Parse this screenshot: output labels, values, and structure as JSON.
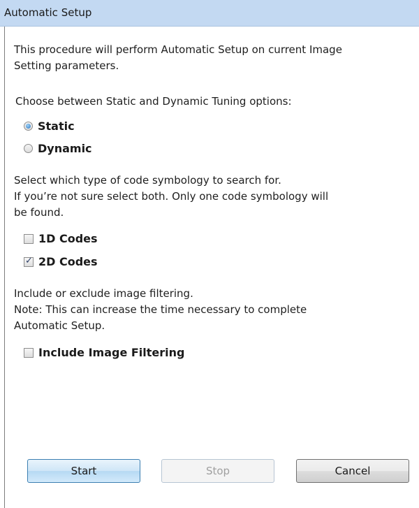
{
  "window": {
    "title": "Automatic Setup"
  },
  "intro": {
    "line1": "This procedure will perform Automatic Setup on current Image",
    "line2": "Setting parameters."
  },
  "tuning": {
    "prompt": "Choose between Static and Dynamic Tuning options:",
    "options": [
      {
        "label": "Static",
        "selected": true
      },
      {
        "label": "Dynamic",
        "selected": false
      }
    ]
  },
  "symbology": {
    "line1": "Select which type of code symbology to search for.",
    "line2": "If you’re not sure select both. Only one code symbology will",
    "line3": "be found.",
    "options": [
      {
        "label": "1D Codes",
        "checked": false
      },
      {
        "label": "2D Codes",
        "checked": true
      }
    ]
  },
  "filtering": {
    "line1": "Include or exclude image filtering.",
    "line2": "Note: This can increase the time necessary to complete",
    "line3": "Automatic Setup.",
    "option": {
      "label": "Include Image Filtering",
      "checked": false
    }
  },
  "buttons": {
    "start": "Start",
    "stop": "Stop",
    "cancel": "Cancel"
  },
  "colors": {
    "titlebar": "#c3d9f2",
    "start_border": "#3c7fb1",
    "radio_dot": "#2a74c0"
  }
}
